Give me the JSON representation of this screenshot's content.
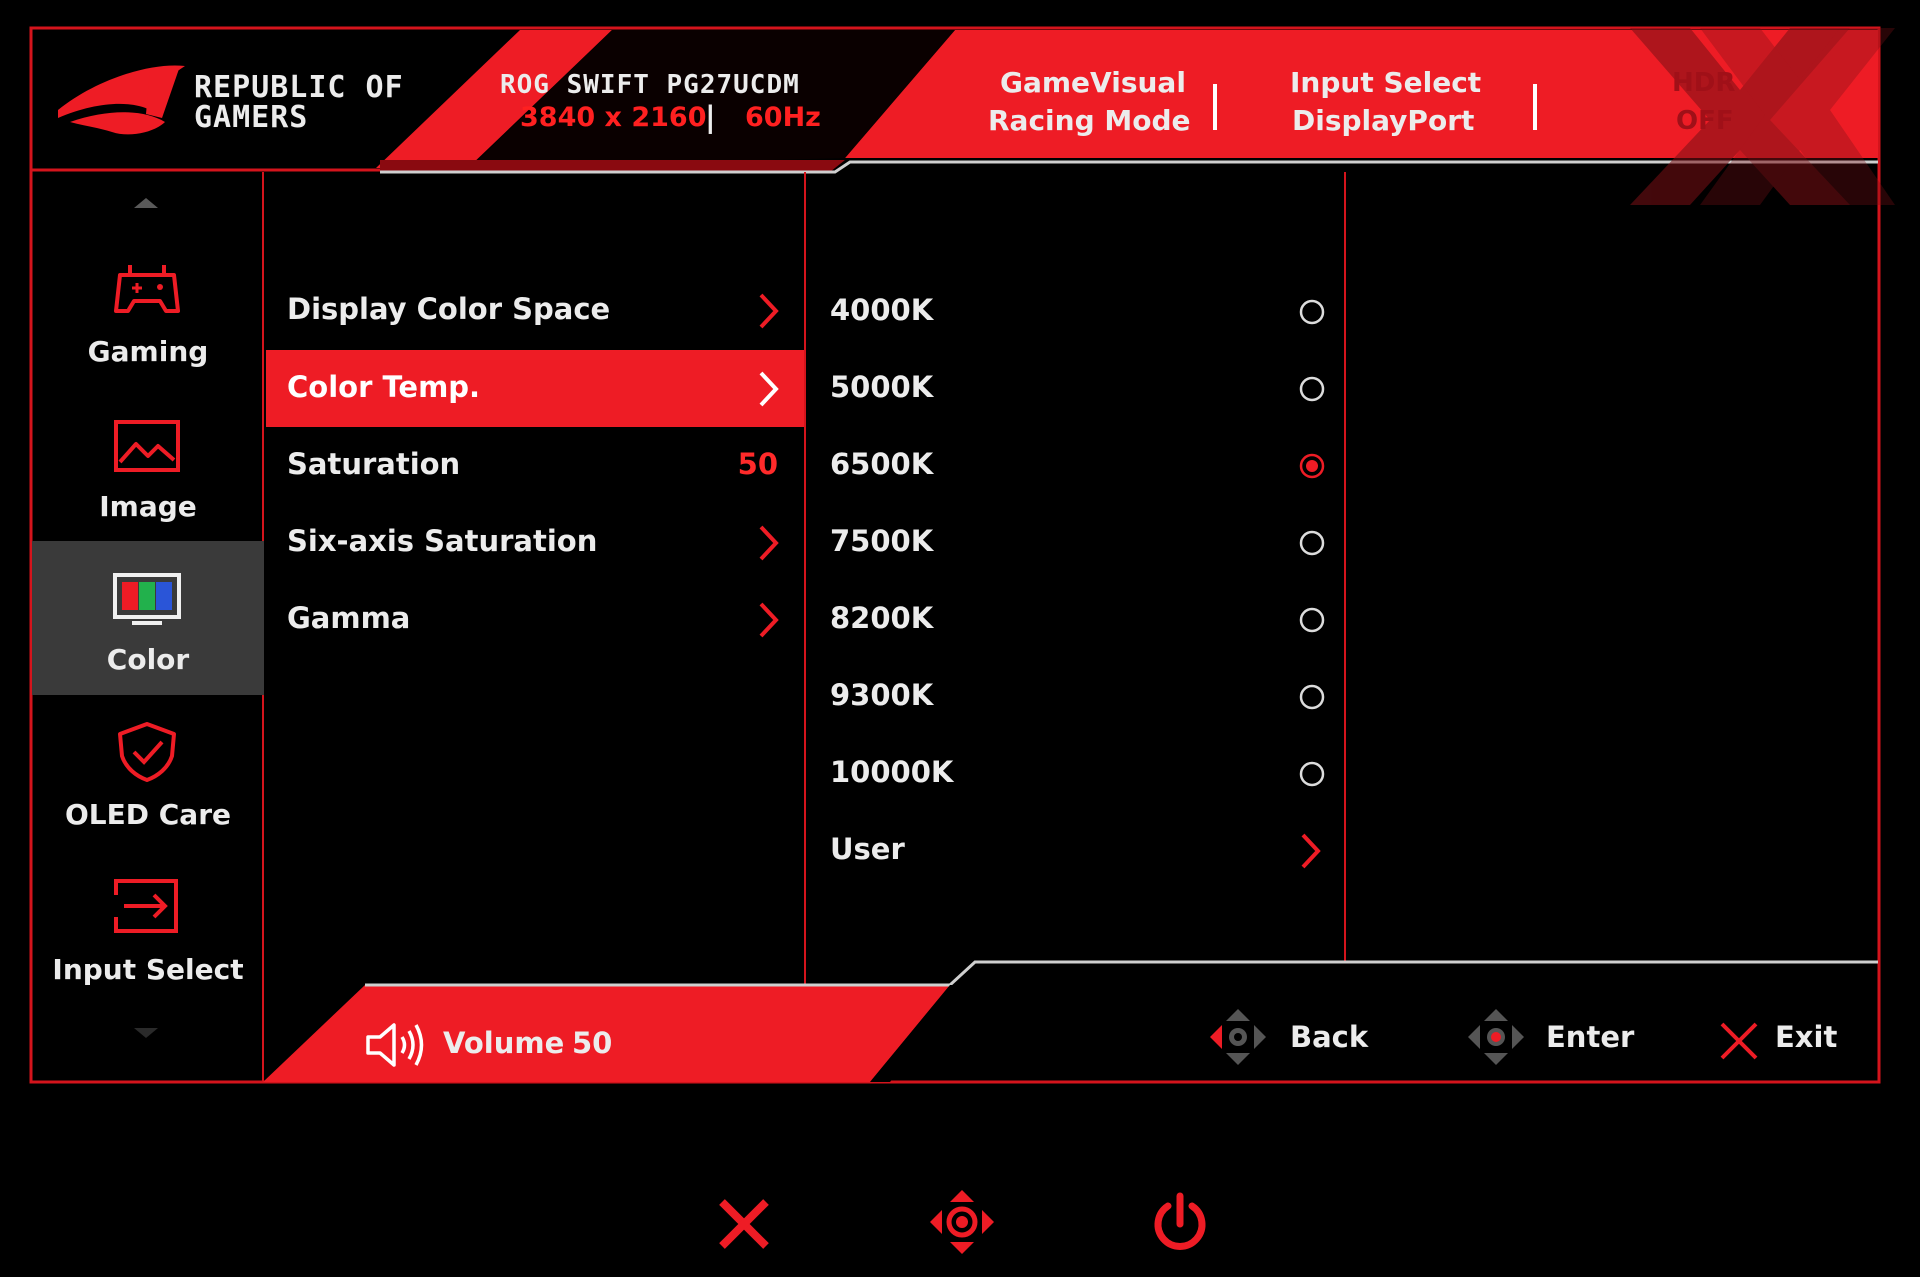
{
  "brand": {
    "line1": "REPUBLIC OF",
    "line2": "GAMERS"
  },
  "model": {
    "name": "ROG SWIFT PG27UCDM",
    "resolution": "3840 x 2160",
    "separator": "|",
    "refresh": "60Hz"
  },
  "status": {
    "gamevisual_title": "GameVisual",
    "gamevisual_value": "Racing Mode",
    "input_title": "Input Select",
    "input_value": "DisplayPort",
    "hdr_title": "HDR",
    "hdr_value": "OFF"
  },
  "sidebar": {
    "items": [
      {
        "label": "Gaming",
        "icon": "gamepad-icon",
        "active": false
      },
      {
        "label": "Image",
        "icon": "picture-icon",
        "active": false
      },
      {
        "label": "Color",
        "icon": "monitor-color-icon",
        "active": true
      },
      {
        "label": "OLED Care",
        "icon": "shield-check-icon",
        "active": false
      },
      {
        "label": "Input Select",
        "icon": "input-arrow-icon",
        "active": false
      }
    ]
  },
  "menu": {
    "items": [
      {
        "label": "Display Color Space",
        "type": "submenu"
      },
      {
        "label": "Color Temp.",
        "type": "submenu",
        "active": true
      },
      {
        "label": "Saturation",
        "type": "value",
        "value": "50"
      },
      {
        "label": "Six-axis Saturation",
        "type": "submenu"
      },
      {
        "label": "Gamma",
        "type": "submenu"
      }
    ]
  },
  "color_temp": {
    "options": [
      {
        "label": "4000K",
        "selected": false
      },
      {
        "label": "5000K",
        "selected": false
      },
      {
        "label": "6500K",
        "selected": true
      },
      {
        "label": "7500K",
        "selected": false
      },
      {
        "label": "8200K",
        "selected": false
      },
      {
        "label": "9300K",
        "selected": false
      },
      {
        "label": "10000K",
        "selected": false
      },
      {
        "label": "User",
        "type": "submenu"
      }
    ]
  },
  "volume": {
    "label": "Volume",
    "value": "50",
    "icon": "speaker-icon"
  },
  "hints": {
    "back": "Back",
    "enter": "Enter",
    "exit": "Exit"
  },
  "colors": {
    "accent": "#ee1c25",
    "dark_red": "#3a0006",
    "panel_bg": "#000000",
    "active_side": "#3a3a3a"
  }
}
